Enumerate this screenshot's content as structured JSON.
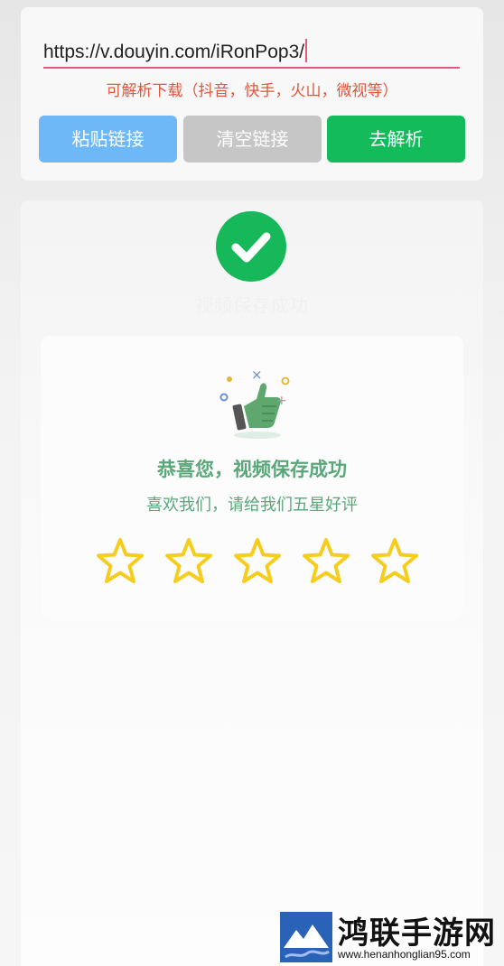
{
  "url_input": {
    "value": "https://v.douyin.com/iRonPop3/"
  },
  "hint": "可解析下载（抖音，快手，火山，微视等）",
  "buttons": {
    "paste": "粘贴链接",
    "clear": "清空链接",
    "parse": "去解析"
  },
  "status_faded": "视频保存成功",
  "success": {
    "title": "恭喜您，视频保存成功",
    "subtitle": "喜欢我们，请给我们五星好评",
    "rating_stars": 5,
    "filled_stars": 0
  },
  "watermark": {
    "name": "鸿联手游网",
    "url": "www.henanhonglian95.com"
  },
  "colors": {
    "accent_green": "#13bb5b",
    "paste_blue": "#6eb8f8",
    "clear_gray": "#c6c6c6",
    "hint_red": "#e0563a",
    "star_yellow": "#f5cd1e"
  }
}
